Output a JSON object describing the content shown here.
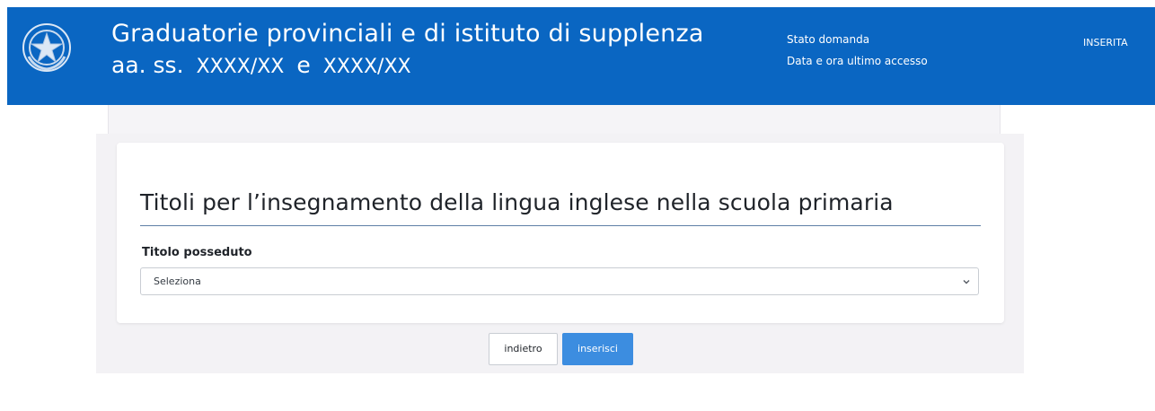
{
  "header": {
    "title_line1": "Graduatorie provinciali e di istituto di supplenza",
    "title_prefix": "aa. ss.",
    "year_from": "XXXX/XX",
    "conjunction": "e",
    "year_to": "XXXX/XX",
    "status_label": "Stato domanda",
    "access_label": "Data e ora ultimo accesso",
    "status_value": "INSERITA",
    "emblem_icon": "italian-republic-emblem-icon"
  },
  "form": {
    "section_title": "Titoli per l’insegnamento della lingua inglese nella scuola primaria",
    "field_label": "Titolo posseduto",
    "select_value": "Seleziona"
  },
  "buttons": {
    "back_label": "indietro",
    "insert_label": "inserisci"
  },
  "colors": {
    "header_bg": "#0a66c2",
    "primary_button": "#3c8de0",
    "title_rule": "#5f7fa6"
  }
}
